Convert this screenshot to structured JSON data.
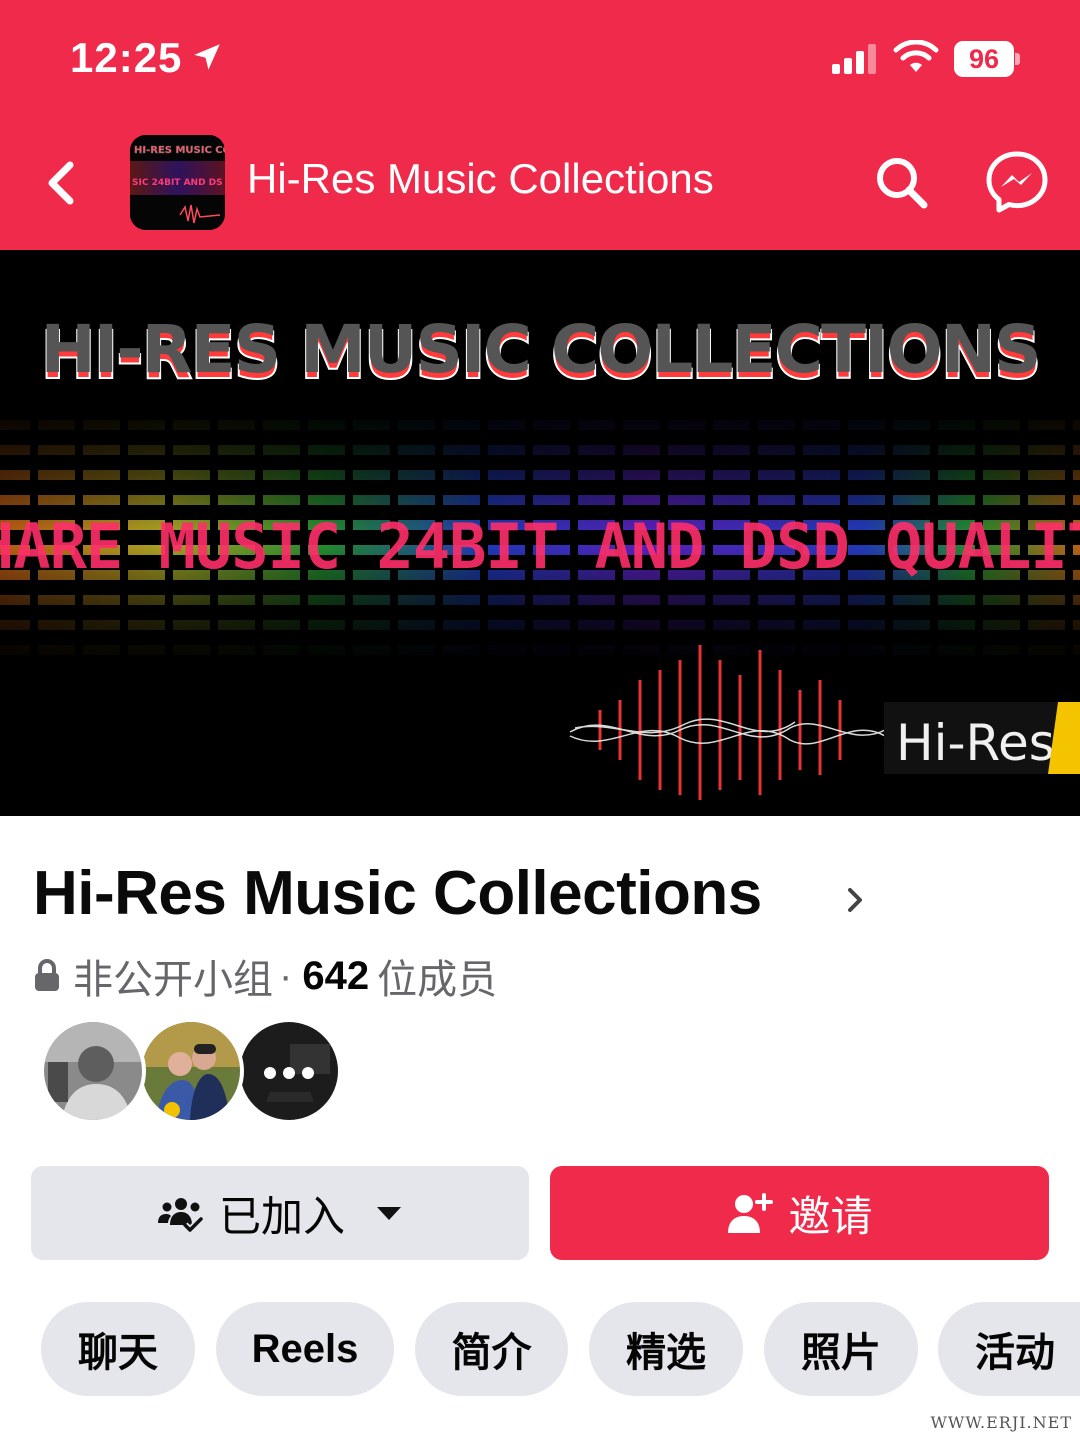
{
  "status_bar": {
    "time": "12:25",
    "battery": "96",
    "icons": [
      "location-arrow-icon",
      "signal-icon",
      "wifi-icon",
      "battery-icon"
    ]
  },
  "nav": {
    "title": "Hi-Res Music Collections",
    "icons": [
      "back-icon",
      "search-icon",
      "messenger-icon"
    ]
  },
  "cover": {
    "headline": "HI-RES MUSIC COLLECTIONS",
    "tagline": "HARE MUSIC 24BIT AND DSD QUALIT",
    "badge": "Hi-Res",
    "thumb_line1": "HI-RES MUSIC COLLECT",
    "thumb_line2": "SIC 24BIT AND DS"
  },
  "group": {
    "name": "Hi-Res Music Collections",
    "privacy": "非公开小组",
    "separator": "·",
    "member_count": "642",
    "member_label": "位成员"
  },
  "buttons": {
    "joined": "已加入",
    "invite": "邀请"
  },
  "tabs": [
    {
      "label": "聊天"
    },
    {
      "label": "Reels"
    },
    {
      "label": "简介"
    },
    {
      "label": "精选"
    },
    {
      "label": "照片"
    },
    {
      "label": "活动"
    }
  ],
  "watermark": "WWW.ERJI.NET",
  "colors": {
    "brand_red": "#ef2a4a",
    "button_gray": "#e4e6eb",
    "meta_gray": "#65676b"
  }
}
